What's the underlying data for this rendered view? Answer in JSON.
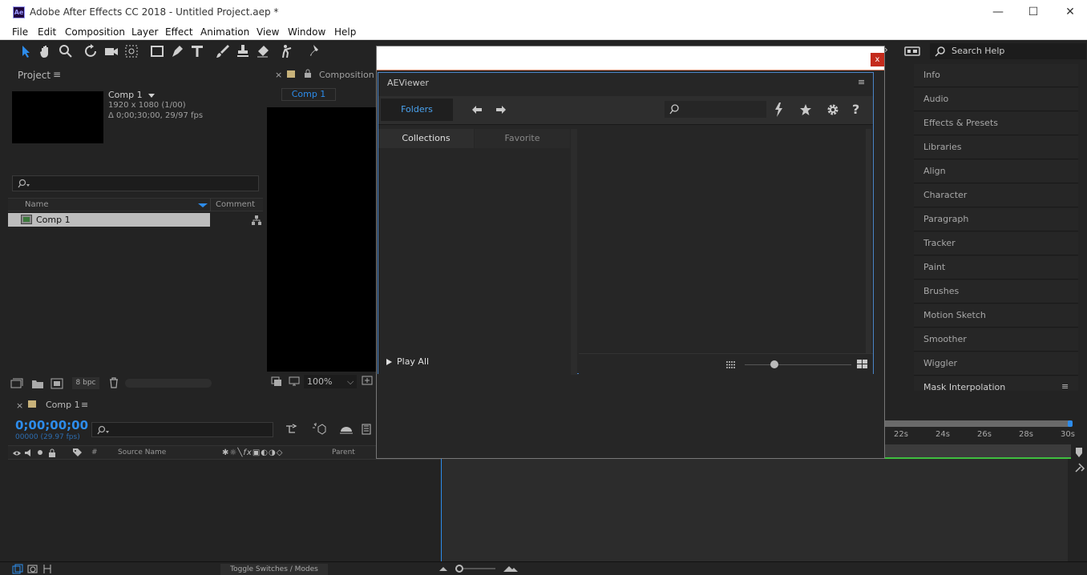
{
  "app": {
    "logo": "Ae",
    "window_title": "Adobe After Effects CC 2018 - Untitled Project.aep *",
    "window_controls": {
      "minimize": "—",
      "maximize": "☐",
      "close": "✕"
    }
  },
  "menu": [
    "File",
    "Edit",
    "Composition",
    "Layer",
    "Effect",
    "Animation",
    "View",
    "Window",
    "Help"
  ],
  "toolbar": {
    "tools": [
      "selection-tool-icon",
      "hand-tool-icon",
      "zoom-tool-icon",
      "rotate-tool-icon",
      "camera-tool-icon",
      "pan-behind-tool-icon",
      "rectangle-tool-icon",
      "pen-tool-icon",
      "type-tool-icon",
      "brush-tool-icon",
      "clone-stamp-tool-icon",
      "eraser-tool-icon",
      "roto-brush-tool-icon",
      "puppet-pin-tool-icon"
    ],
    "search_help": "Search Help"
  },
  "project_panel": {
    "title": "Project",
    "menu_icon": "≡",
    "comp_name": "Comp 1",
    "comp_res": "1920 x 1080 (1/00)",
    "comp_duration": "Δ 0;00;30;00, 29/97 fps",
    "columns": {
      "name": "Name",
      "comment": "Comment"
    },
    "items": [
      {
        "name": "Comp 1"
      }
    ],
    "bpc": "8 bpc"
  },
  "composition_panel": {
    "close": "×",
    "title": "Composition",
    "tab": "Comp 1",
    "zoom": "100%"
  },
  "right_panel": {
    "items": [
      "Info",
      "Audio",
      "Effects & Presets",
      "Libraries",
      "Align",
      "Character",
      "Paragraph",
      "Tracker",
      "Paint",
      "Brushes",
      "Motion Sketch",
      "Smoother",
      "Wiggler",
      "Mask Interpolation"
    ]
  },
  "timeline": {
    "close": "×",
    "tab": "Comp 1",
    "menu_icon": "≡",
    "timecode": "0;00;00;00",
    "frames": "00000 (29.97 fps)",
    "columns": {
      "hash": "#",
      "source_name": "Source Name",
      "parent": "Parent"
    },
    "ruler": [
      "22s",
      "24s",
      "26s",
      "28s",
      "30s"
    ],
    "toggle": "Toggle Switches / Modes"
  },
  "dialog": {
    "close": "x",
    "panel_title": "AEViewer",
    "menu_icon": "≡",
    "tabs": {
      "folders": "Folders",
      "collections": "Collections",
      "favorite": "Favorite"
    },
    "play_all": "Play All"
  },
  "colors": {
    "accent": "#2d8ceb",
    "bg": "#232323",
    "panel": "#262626",
    "dialog_close": "#c42b1c",
    "playhead": "#2d8ceb"
  }
}
